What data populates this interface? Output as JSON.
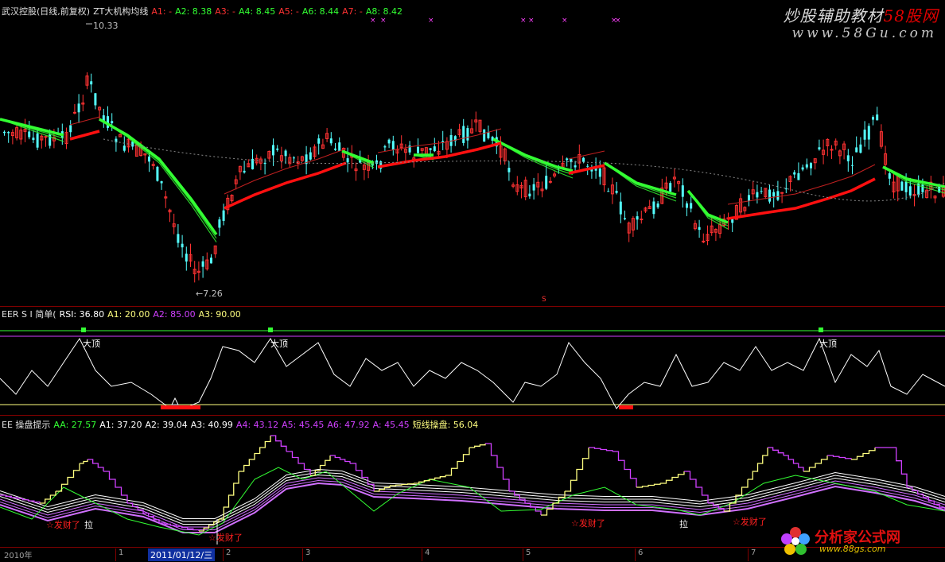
{
  "colors": {
    "up": "#ff3232",
    "down": "#54ffff",
    "green": "#33ff33",
    "red": "#ff1010",
    "magenta": "#d040ff",
    "yellow": "#ffff80",
    "white": "#ffffff"
  },
  "main": {
    "stock": "武汉控股(日线,前复权)",
    "indicator": "ZT大机构均线",
    "params": [
      {
        "label": "A1: -",
        "color": "#ff3232"
      },
      {
        "label": "A2: 8.38",
        "color": "#33ff33"
      },
      {
        "label": "A3: -",
        "color": "#ff3232"
      },
      {
        "label": "A4: 8.45",
        "color": "#33ff33"
      },
      {
        "label": "A5: -",
        "color": "#ff3232"
      },
      {
        "label": "A6: 8.44",
        "color": "#33ff33"
      },
      {
        "label": "A7: -",
        "color": "#ff3232"
      },
      {
        "label": "A8: 8.42",
        "color": "#33ff33"
      }
    ],
    "high_label": "10.33",
    "low_label": "←7.26",
    "marker_s": "S"
  },
  "rsi": {
    "title": "EER S I 简单(",
    "params": [
      {
        "label": "RSI: 36.80",
        "color": "#ffffff"
      },
      {
        "label": "A1: 20.00",
        "color": "#ffff80"
      },
      {
        "label": "A2: 85.00",
        "color": "#d040ff"
      },
      {
        "label": "A3: 90.00",
        "color": "#ffff80"
      }
    ],
    "top_label": "大顶"
  },
  "op": {
    "title": "EE 操盘提示",
    "params": [
      {
        "label": "AA: 27.57",
        "color": "#33ff33"
      },
      {
        "label": "A1: 37.20",
        "color": "#ffffff"
      },
      {
        "label": "A2: 39.04",
        "color": "#ffffff"
      },
      {
        "label": "A3: 40.99",
        "color": "#ffffff"
      },
      {
        "label": "A4: 43.12",
        "color": "#d040ff"
      },
      {
        "label": "A5: 45.45",
        "color": "#d040ff"
      },
      {
        "label": "A6: 47.92",
        "color": "#d040ff"
      },
      {
        "label": "A: 45.45",
        "color": "#d040ff"
      },
      {
        "label": "短线操盘: 56.04",
        "color": "#ffff80"
      }
    ],
    "signal_buy": "☆发财了",
    "signal_pull": "拉"
  },
  "axis": {
    "year": "2010年",
    "date": "2011/01/12/三",
    "months": [
      "1",
      "2",
      "3",
      "4",
      "5",
      "6",
      "7"
    ]
  },
  "watermark": {
    "brand": "炒股辅助教材",
    "brand_red": "58股网",
    "url": "www.58Gu.com"
  },
  "logo": {
    "text": "分析家公式网",
    "url": "www.88gs.com"
  }
}
